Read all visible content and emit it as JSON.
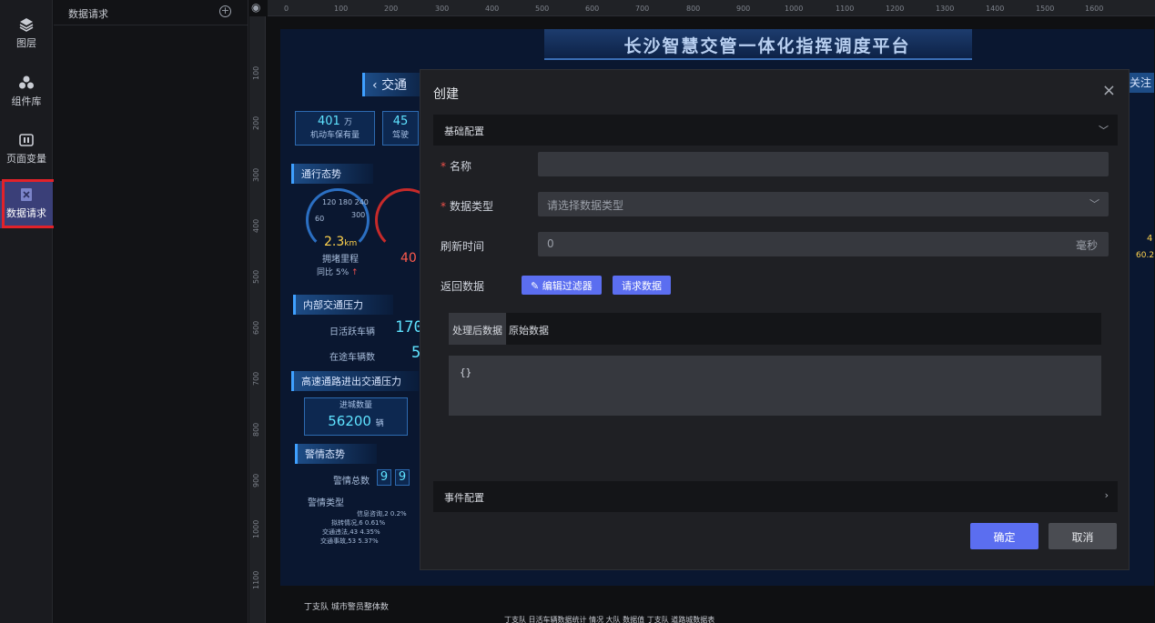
{
  "rail": {
    "items": [
      {
        "label": "图层",
        "icon": "layers-icon"
      },
      {
        "label": "组件库",
        "icon": "components-icon"
      },
      {
        "label": "页面变量",
        "icon": "variables-icon"
      },
      {
        "label": "数据请求",
        "icon": "data-request-icon",
        "active": true
      }
    ]
  },
  "panel": {
    "title": "数据请求",
    "add_icon": "+"
  },
  "ruler": {
    "top_ticks": [
      "0",
      "100",
      "200",
      "300",
      "400",
      "500",
      "600",
      "700",
      "800",
      "900",
      "1000",
      "1100",
      "1200",
      "1300",
      "1400",
      "1500",
      "1600"
    ],
    "left_ticks": [
      "100",
      "200",
      "300",
      "400",
      "500",
      "600",
      "700",
      "800",
      "900",
      "1000",
      "1100"
    ]
  },
  "dashboard": {
    "title": "长沙智慧交管一体化指挥调度平台",
    "section_traffic": "交通",
    "right_tab": "关注",
    "stat1_value": "401",
    "stat1_unit": "万",
    "stat1_label": "机动车保有量",
    "stat2_value": "45",
    "stat2_label": "驾驶",
    "sec_flow": "通行态势",
    "gauge_value": "2.3",
    "gauge_unit": "km",
    "gauge_label": "拥堵里程",
    "gauge_ticks": "120  180  240",
    "gauge_left": "60",
    "gauge_right": "300",
    "yoy": "同比",
    "yoy_value": "5%",
    "red_value": "40",
    "sec_internal": "内部交通压力",
    "active_vehicles": "日活跃车辆",
    "active_value": "170",
    "on_road": "在途车辆数",
    "on_road_value": "5",
    "sec_highway": "高速通路进出交通压力",
    "inbound_label": "进城数量",
    "inbound_value": "56200",
    "inbound_unit": "辆",
    "sec_alarm": "警情态势",
    "alarm_total": "警情总数",
    "alarm_digits": [
      "9",
      "9"
    ],
    "alarm_type": "警情类型",
    "legend": [
      "信息咨询,2 0.2%",
      "拟转情况,6 0.61%",
      "交通违法,43 4.35%",
      "交通事故,53 5.37%"
    ],
    "right_values": [
      "4",
      "60.2"
    ]
  },
  "bottom": {
    "line1": "丁支队 城市警员整体数",
    "line2": "丁支队 日活车辆数据统计 情况 大队 数据值    丁支队 道路城数据表"
  },
  "dialog": {
    "title": "创建",
    "close_icon": "×",
    "section_basic": "基础配置",
    "name_label": "名称",
    "name_value": "",
    "type_label": "数据类型",
    "type_placeholder": "请选择数据类型",
    "refresh_label": "刷新时间",
    "refresh_value": "0",
    "refresh_unit": "毫秒",
    "return_label": "返回数据",
    "edit_filter": "编辑过滤器",
    "request_data": "请求数据",
    "tab_processed": "处理后数据",
    "tab_raw": "原始数据",
    "code": "{}",
    "section_event": "事件配置",
    "confirm": "确定",
    "cancel": "取消"
  }
}
